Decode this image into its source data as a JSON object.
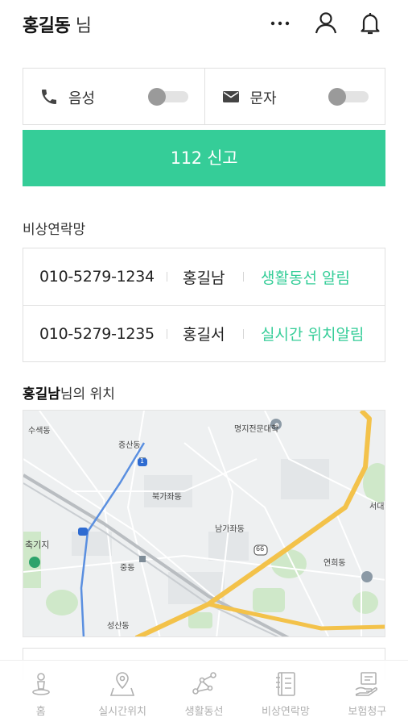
{
  "header": {
    "user_name": "홍길동",
    "user_suffix": "님",
    "icons": [
      "more-icon",
      "user-icon",
      "bell-icon"
    ]
  },
  "toggles": [
    {
      "icon": "phone-icon",
      "label": "음성",
      "on": false
    },
    {
      "icon": "mail-icon",
      "label": "문자",
      "on": false
    }
  ],
  "report_button": "112 신고",
  "contacts_section": {
    "title": "비상연락망",
    "rows": [
      {
        "phone": "010-5279-1234",
        "name": "홍길남",
        "action": "생활동선 알림"
      },
      {
        "phone": "010-5279-1235",
        "name": "홍길서",
        "action": "실시간 위치알림"
      }
    ]
  },
  "location_section": {
    "name": "홍길남",
    "suffix": "님의 위치"
  },
  "map": {
    "labels": [
      "수색동",
      "증산동",
      "명지전문대학",
      "북가좌동",
      "남가좌동",
      "서대",
      "연희동",
      "중동",
      "성산동",
      "축기지",
      "66",
      "1"
    ]
  },
  "tabs": [
    {
      "label": "홈",
      "icon": "home-pin-icon"
    },
    {
      "label": "실시간위치",
      "icon": "map-pin-icon"
    },
    {
      "label": "생활동선",
      "icon": "route-icon"
    },
    {
      "label": "비상연락망",
      "icon": "contact-book-icon"
    },
    {
      "label": "보험청구",
      "icon": "insurance-claim-icon"
    }
  ],
  "colors": {
    "accent": "#35cd98",
    "border": "#e0e0e0",
    "tab_inactive": "#b0b0b0",
    "map_road_major": "#f3c24a"
  }
}
